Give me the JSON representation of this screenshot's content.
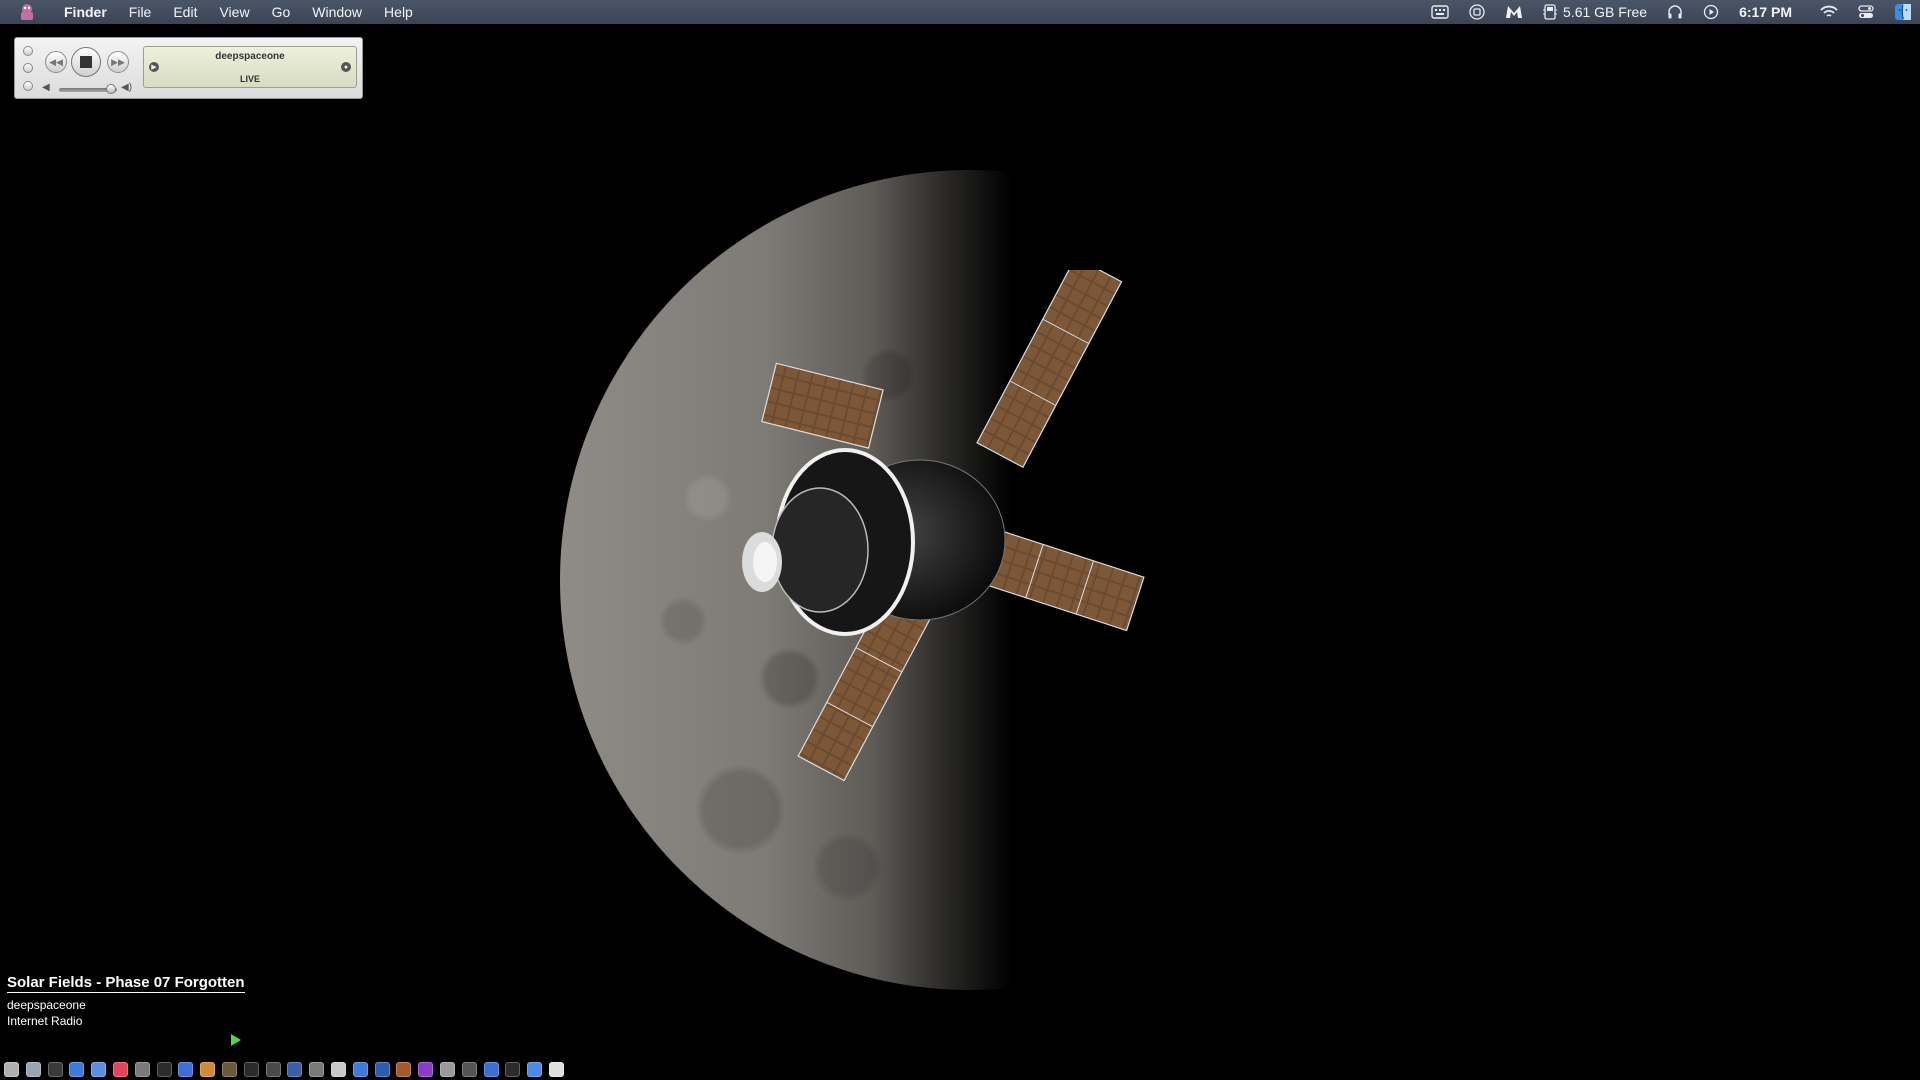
{
  "menubar": {
    "app_name": "Finder",
    "items": [
      "File",
      "Edit",
      "View",
      "Go",
      "Window",
      "Help"
    ],
    "status": {
      "icons": [
        "keyboard-viewer-icon",
        "record-icon",
        "malwarebytes-icon",
        "disk-icon",
        "headphones-icon",
        "media-play-icon",
        "wifi-icon",
        "control-center-icon",
        "finder-face-icon"
      ],
      "disk_free": "5.61 GB Free",
      "time": "6:17 PM"
    }
  },
  "player": {
    "station": "deepspaceone",
    "status": "LIVE"
  },
  "now_playing": {
    "title": "Solar Fields - Phase 07 Forgotten",
    "station": "deepspaceone",
    "source": "Internet Radio"
  },
  "dock": {
    "colors": [
      "#b0b0b0",
      "#9aa4b0",
      "#3a3a3a",
      "#3d7bd9",
      "#5b8de0",
      "#e2445c",
      "#7a7a7a",
      "#2c2c2c",
      "#3f6fd6",
      "#d08a35",
      "#6b5a3a",
      "#2b2b2b",
      "#4a4a4a",
      "#3a5fa8",
      "#7a7a7a",
      "#c9c9c9",
      "#3d7bd9",
      "#2a5fb0",
      "#a55a2a",
      "#8a3cc4",
      "#9a9a9a",
      "#555555",
      "#3b6fd0",
      "#2c2c2c",
      "#4a8ae0",
      "#e0e0e0"
    ]
  },
  "colors": {
    "menubar": "#434d5e",
    "desktop": "#000000",
    "play_indicator": "#4fd44f"
  }
}
